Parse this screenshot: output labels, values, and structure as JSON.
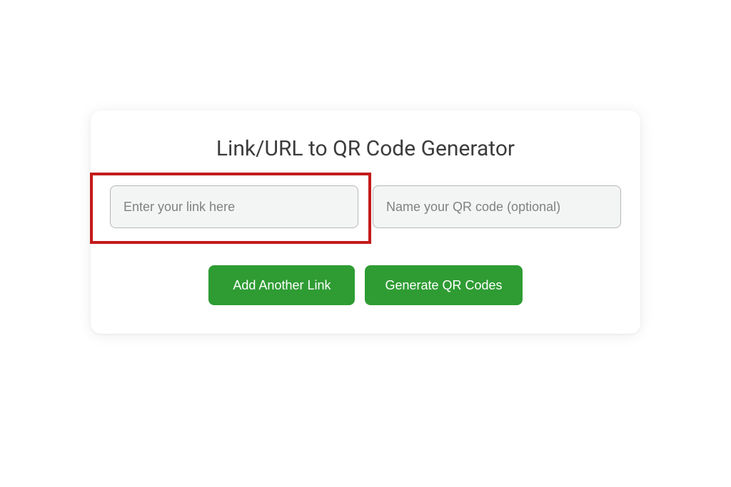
{
  "card": {
    "title": "Link/URL to QR Code Generator",
    "inputs": {
      "link": {
        "placeholder": "Enter your link here",
        "value": "",
        "highlighted": true
      },
      "name": {
        "placeholder": "Name your QR code (optional)",
        "value": ""
      }
    },
    "buttons": {
      "add_another": "Add Another Link",
      "generate": "Generate QR Codes"
    }
  },
  "colors": {
    "button_bg": "#2e9c33",
    "highlight_border": "#c41a1a"
  }
}
